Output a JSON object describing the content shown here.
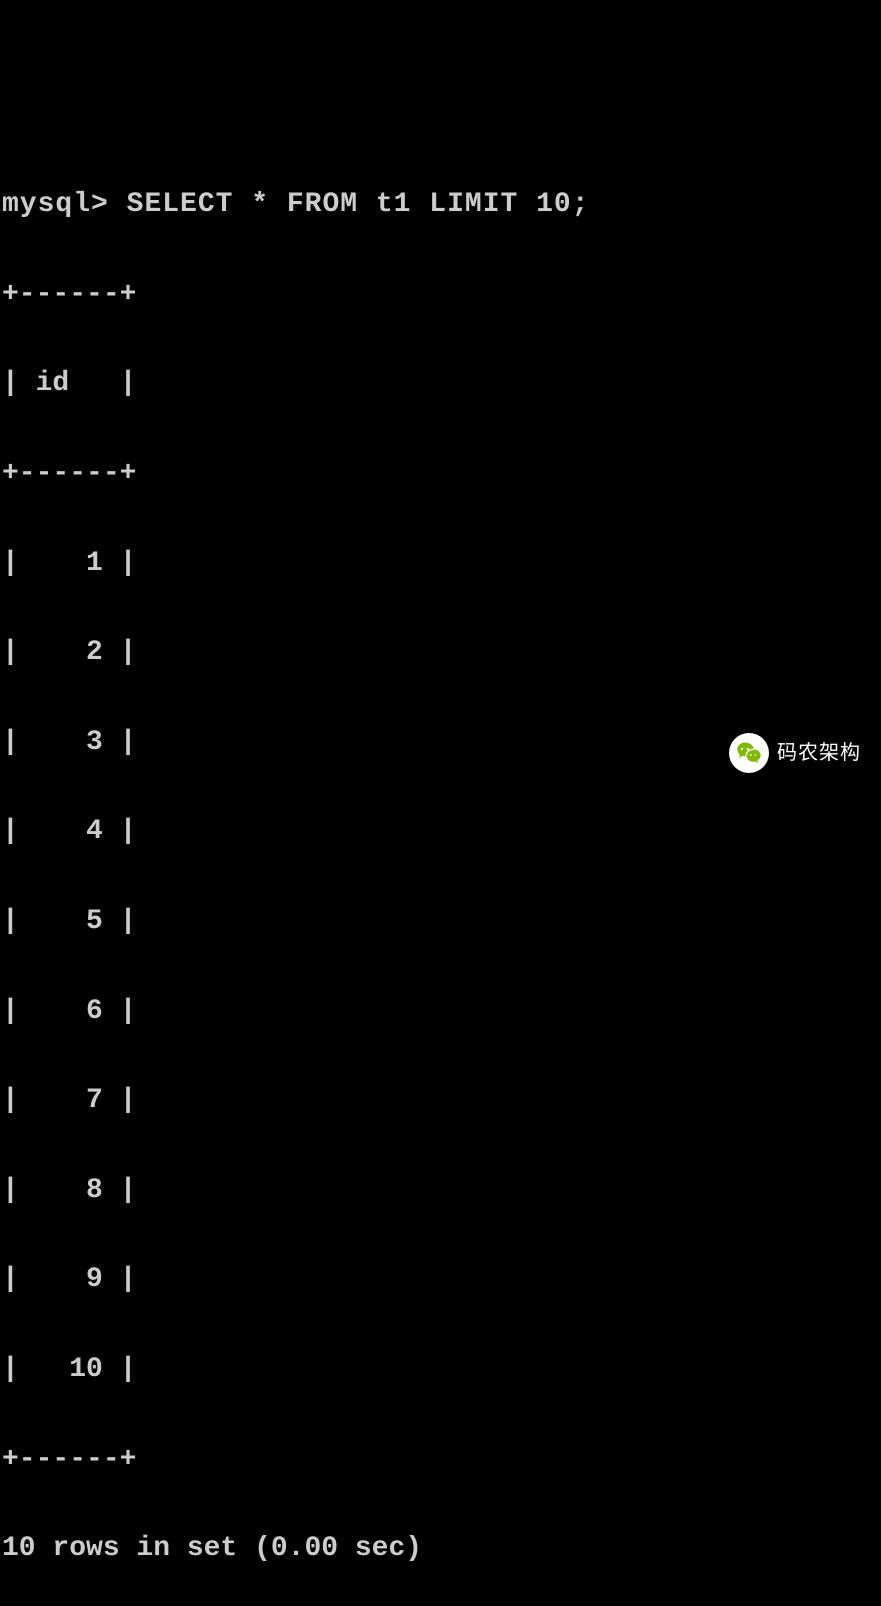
{
  "prompt": "mysql>",
  "command": "SELECT * FROM t1 LIMIT 10;",
  "table": {
    "border_top": "+------+",
    "header_line": "| id   |",
    "border_mid": "+------+",
    "rows": [
      "|    1 |",
      "|    2 |",
      "|    3 |",
      "|    4 |",
      "|    5 |",
      "|    6 |",
      "|    7 |",
      "|    8 |",
      "|    9 |",
      "|   10 |"
    ],
    "border_bottom": "+------+"
  },
  "result": "10 rows in set (0.00 sec)",
  "watermark": "码农架构"
}
